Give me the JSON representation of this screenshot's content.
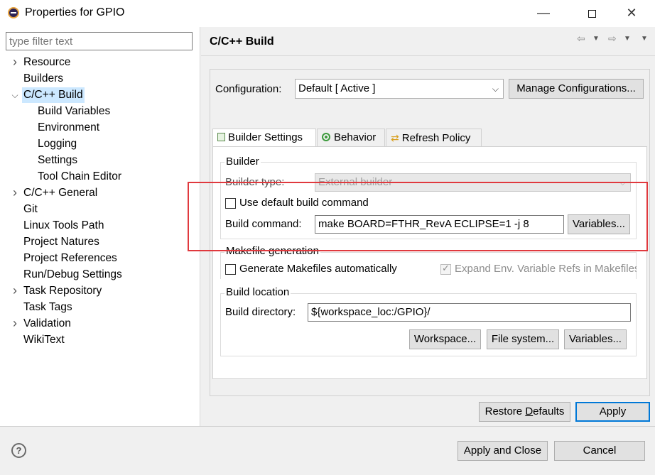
{
  "window": {
    "title": "Properties for GPIO",
    "minimize": "—",
    "close": "✕"
  },
  "filter": {
    "placeholder": "type filter text"
  },
  "tree": [
    {
      "label": "Resource",
      "expandable": true,
      "expanded": false,
      "indent": 0
    },
    {
      "label": "Builders",
      "expandable": false,
      "indent": 0
    },
    {
      "label": "C/C++ Build",
      "expandable": true,
      "expanded": true,
      "selected": true,
      "indent": 0
    },
    {
      "label": "Build Variables",
      "expandable": false,
      "indent": 1
    },
    {
      "label": "Environment",
      "expandable": false,
      "indent": 1
    },
    {
      "label": "Logging",
      "expandable": false,
      "indent": 1
    },
    {
      "label": "Settings",
      "expandable": false,
      "indent": 1
    },
    {
      "label": "Tool Chain Editor",
      "expandable": false,
      "indent": 1
    },
    {
      "label": "C/C++ General",
      "expandable": true,
      "expanded": false,
      "indent": 0
    },
    {
      "label": "Git",
      "expandable": false,
      "indent": 0
    },
    {
      "label": "Linux Tools Path",
      "expandable": false,
      "indent": 0
    },
    {
      "label": "Project Natures",
      "expandable": false,
      "indent": 0
    },
    {
      "label": "Project References",
      "expandable": false,
      "indent": 0
    },
    {
      "label": "Run/Debug Settings",
      "expandable": false,
      "indent": 0
    },
    {
      "label": "Task Repository",
      "expandable": true,
      "expanded": false,
      "indent": 0
    },
    {
      "label": "Task Tags",
      "expandable": false,
      "indent": 0
    },
    {
      "label": "Validation",
      "expandable": true,
      "expanded": false,
      "indent": 0
    },
    {
      "label": "WikiText",
      "expandable": false,
      "indent": 0
    }
  ],
  "page": {
    "title": "C/C++ Build",
    "configuration_label": "Configuration:",
    "configuration_value": "Default  [ Active ]",
    "manage_configurations": "Manage Configurations..."
  },
  "tabs": [
    {
      "label": "Builder Settings",
      "icon": "builder-settings-icon",
      "active": true
    },
    {
      "label": "Behavior",
      "icon": "behavior-icon",
      "active": false
    },
    {
      "label": "Refresh Policy",
      "icon": "refresh-policy-icon",
      "active": false
    }
  ],
  "builder": {
    "group_title": "Builder",
    "type_label": "Builder type:",
    "type_value": "External builder",
    "use_default_label": "Use default build command",
    "use_default_checked": false,
    "build_command_label": "Build command:",
    "build_command_value": "make BOARD=FTHR_RevA ECLIPSE=1 -j 8",
    "variables_button": "Variables..."
  },
  "makefile": {
    "group_title": "Makefile generation",
    "generate_label": "Generate Makefiles automatically",
    "generate_checked": false,
    "expand_env_label": "Expand Env. Variable Refs in Makefiles",
    "expand_env_checked": true
  },
  "location": {
    "group_title": "Build location",
    "directory_label": "Build directory:",
    "directory_value": "${workspace_loc:/GPIO}/",
    "workspace_button": "Workspace...",
    "filesystem_button": "File system...",
    "variables_button": "Variables..."
  },
  "actions": {
    "restore_defaults_prefix": "Restore ",
    "restore_defaults_mnemonic": "D",
    "restore_defaults_suffix": "efaults",
    "apply": "Apply",
    "apply_and_close": "Apply and Close",
    "cancel": "Cancel",
    "help": "?"
  },
  "colors": {
    "highlight": "#e0393e",
    "selection": "#cce8ff",
    "default_button_border": "#0078d7"
  }
}
